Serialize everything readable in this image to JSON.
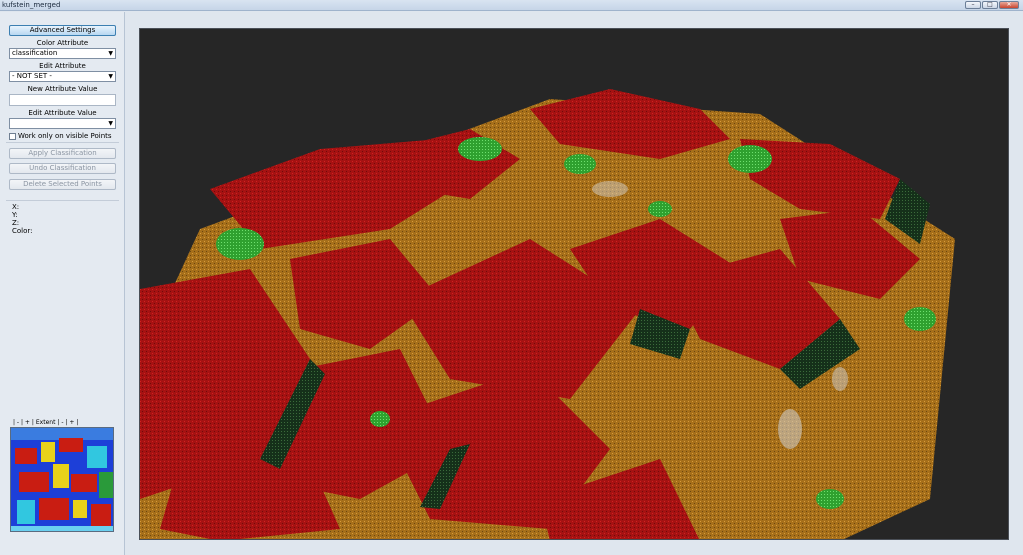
{
  "window": {
    "title": "kufstein_merged"
  },
  "window_controls": {
    "minimize": "–",
    "maximize": "□",
    "close": "✕"
  },
  "panel": {
    "advanced_settings": "Advanced Settings",
    "color_attribute_label": "Color Attribute",
    "color_attribute_value": "classification",
    "edit_attribute_label": "Edit Attribute",
    "edit_attribute_value": "- NOT SET -",
    "new_attribute_value_label": "New Attribute Value",
    "edit_attribute_value_label": "Edit Attribute Value",
    "work_only_visible": "Work only on visible Points",
    "apply_classification": "Apply Classification",
    "undo_classification": "Undo Classification",
    "delete_selected_points": "Delete Selected Points",
    "x_label": "X:",
    "y_label": "Y:",
    "z_label": "Z:",
    "color_label": "Color:"
  },
  "minimap_toolbar": {
    "left": "| - | + |",
    "extent": "Extent",
    "right": "| - | + |"
  },
  "colors": {
    "roof": "#b51514",
    "ground": "#b5791b",
    "vegetation": "#33b233",
    "dark_structure": "#1d3a1d",
    "background": "#262626"
  }
}
